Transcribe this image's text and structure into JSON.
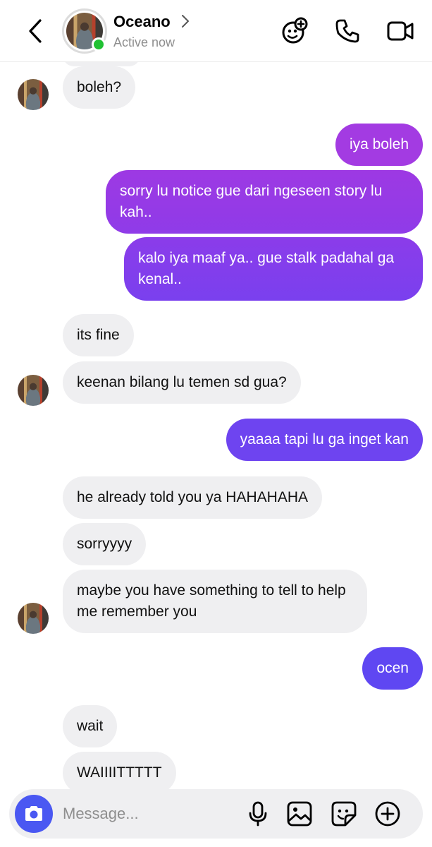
{
  "header": {
    "name": "Oceano",
    "status": "Active now"
  },
  "icons": {
    "back": "chevron-left-icon",
    "profile_chevron": "chevron-right-icon",
    "effects": "effects-sparkle-icon",
    "call": "phone-icon",
    "video": "video-camera-icon",
    "camera": "camera-icon",
    "mic": "microphone-icon",
    "gallery": "image-icon",
    "sticker": "sticker-icon",
    "add": "plus-circle-icon"
  },
  "messages": [
    {
      "dir": "in",
      "text": "boleh?"
    },
    {
      "dir": "out",
      "text": "iya boleh"
    },
    {
      "dir": "out",
      "text": "sorry lu notice gue dari ngeseen story lu kah.."
    },
    {
      "dir": "out",
      "text": "kalo iya maaf ya.. gue stalk padahal ga kenal.."
    },
    {
      "dir": "in",
      "text": "its fine"
    },
    {
      "dir": "in",
      "text": "keenan bilang lu temen sd gua?"
    },
    {
      "dir": "out",
      "text": "yaaaa tapi lu ga inget kan"
    },
    {
      "dir": "in",
      "text": "he already told you ya HAHAHAHA"
    },
    {
      "dir": "in",
      "text": "sorryyyy"
    },
    {
      "dir": "in",
      "text": "maybe you have something to tell to help me remember you"
    },
    {
      "dir": "out",
      "text": "ocen"
    },
    {
      "dir": "in",
      "text": "wait"
    },
    {
      "dir": "in",
      "text": "WAIIIITTTTT"
    }
  ],
  "composer": {
    "placeholder": "Message..."
  },
  "colors": {
    "bubble_in": "#efeff1",
    "bubble_out_top": "#a13ae0",
    "bubble_out_bottom": "#5e46f0",
    "online": "#20c133",
    "camera_button": "#4a58f2"
  }
}
